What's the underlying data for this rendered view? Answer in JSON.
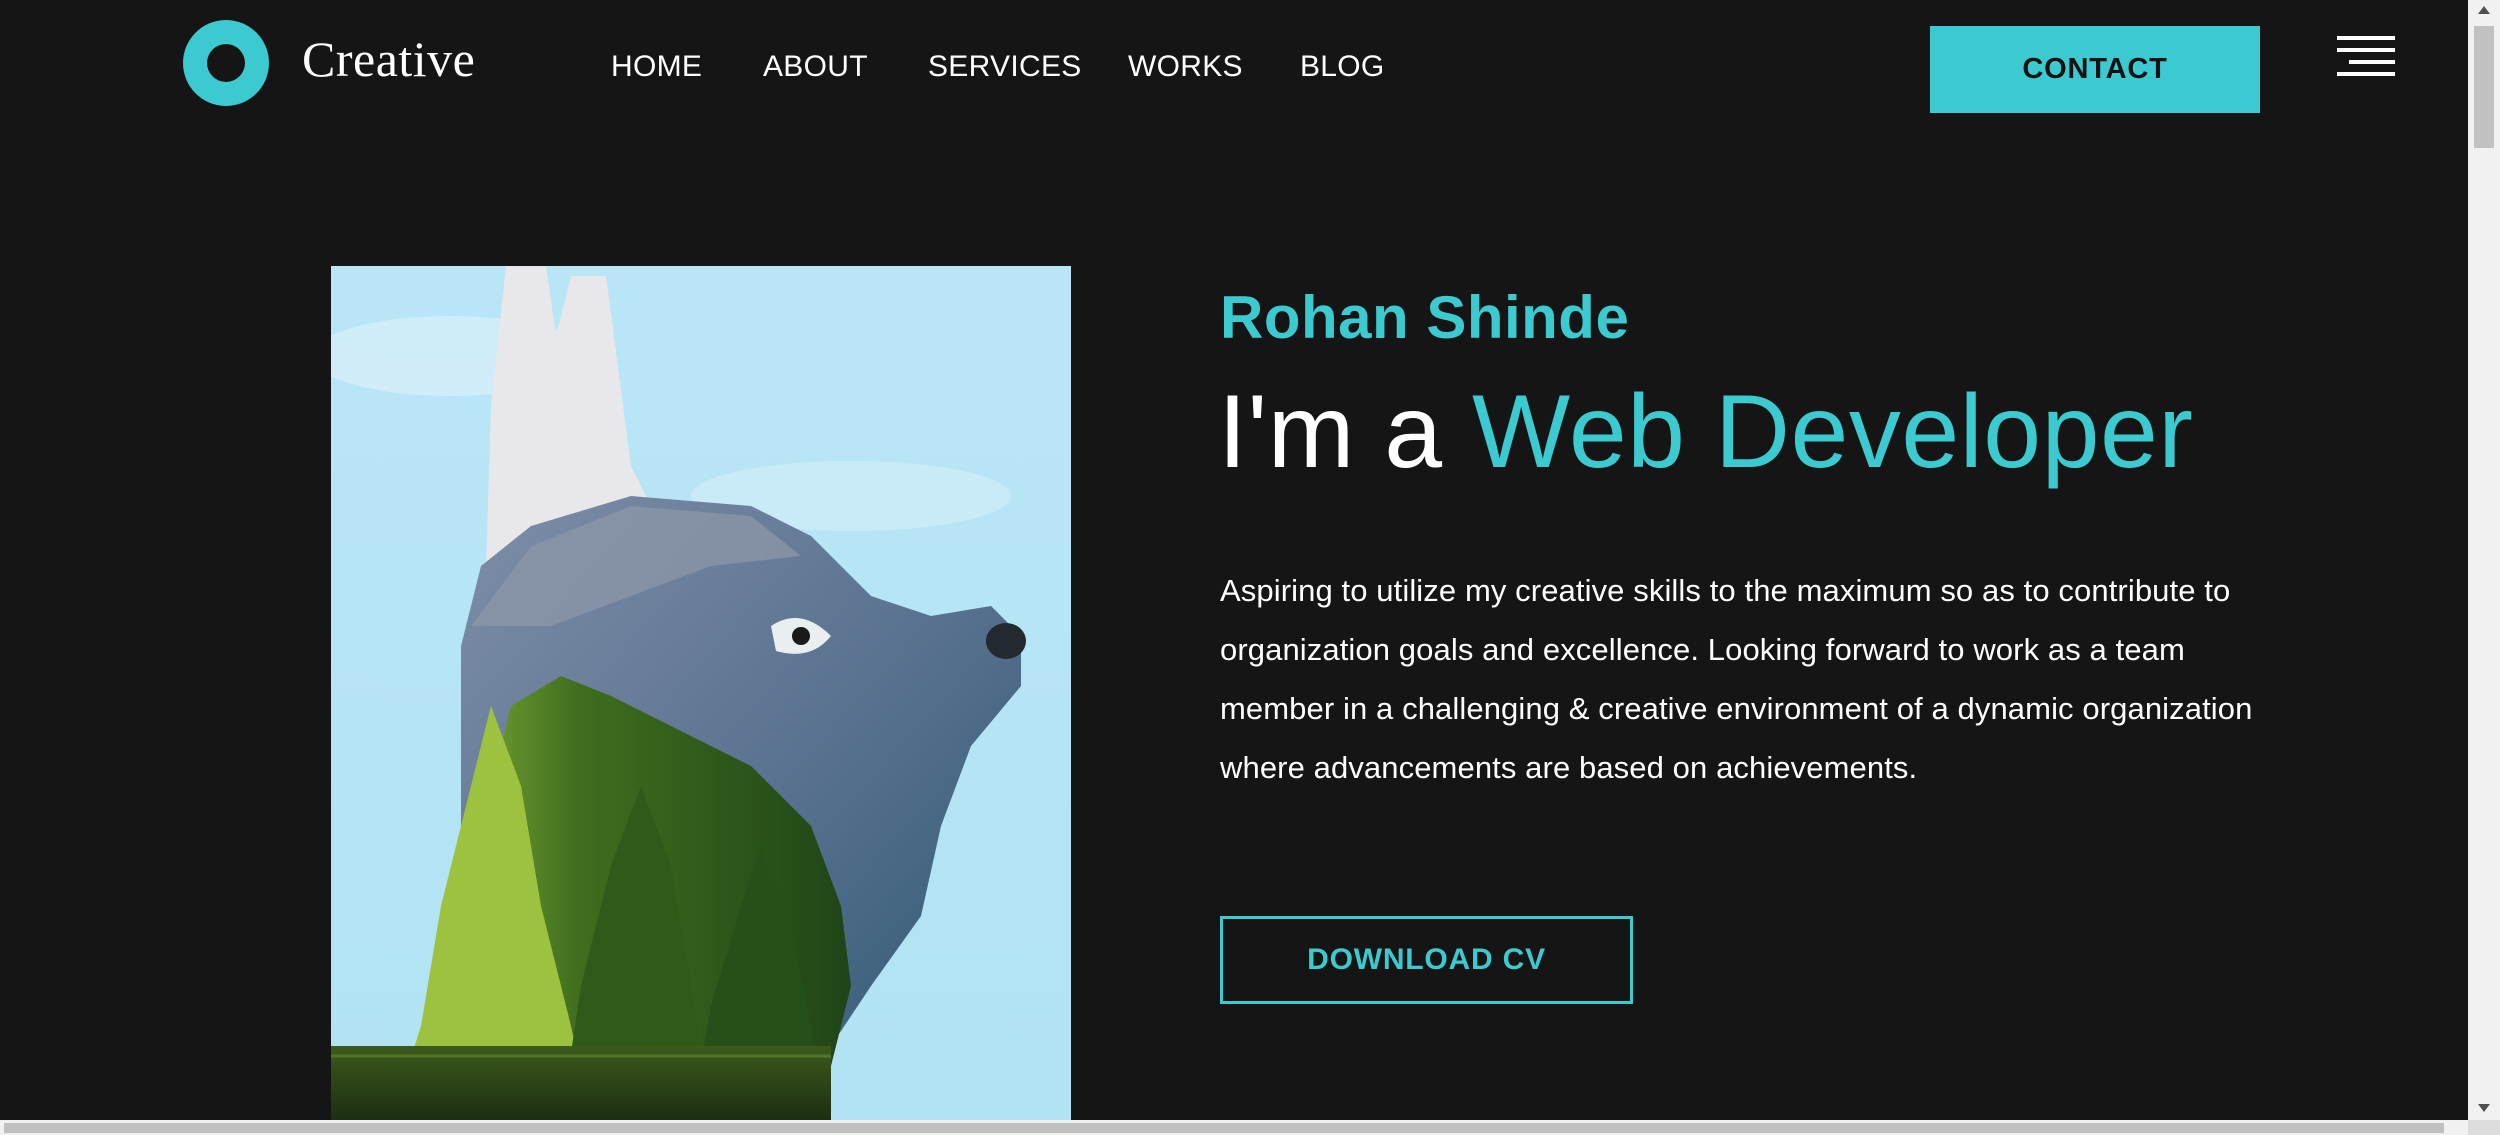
{
  "brand": {
    "name": "Creative",
    "accent_color": "#3ccad1",
    "background_color": "#151515"
  },
  "nav": {
    "items": [
      {
        "label": "HOME"
      },
      {
        "label": "ABOUT"
      },
      {
        "label": "SERVICES"
      },
      {
        "label": "WORKS"
      },
      {
        "label": "BLOG"
      }
    ],
    "contact_label": "CONTACT",
    "menu_icon": "hamburger-menu-icon"
  },
  "hero": {
    "image_icon": "wolf-forest-double-exposure-image",
    "name": "Rohan Shinde",
    "title_lead": "I'm a",
    "title_accent": "Web Developer",
    "description": "Aspiring to utilize my creative skills to the maximum so as to contribute to organization goals and excellence. Looking forward to work as a team member in a challenging & creative environment of a dynamic organization where advancements are based on achievements.",
    "cv_button_label": "DOWNLOAD CV"
  }
}
